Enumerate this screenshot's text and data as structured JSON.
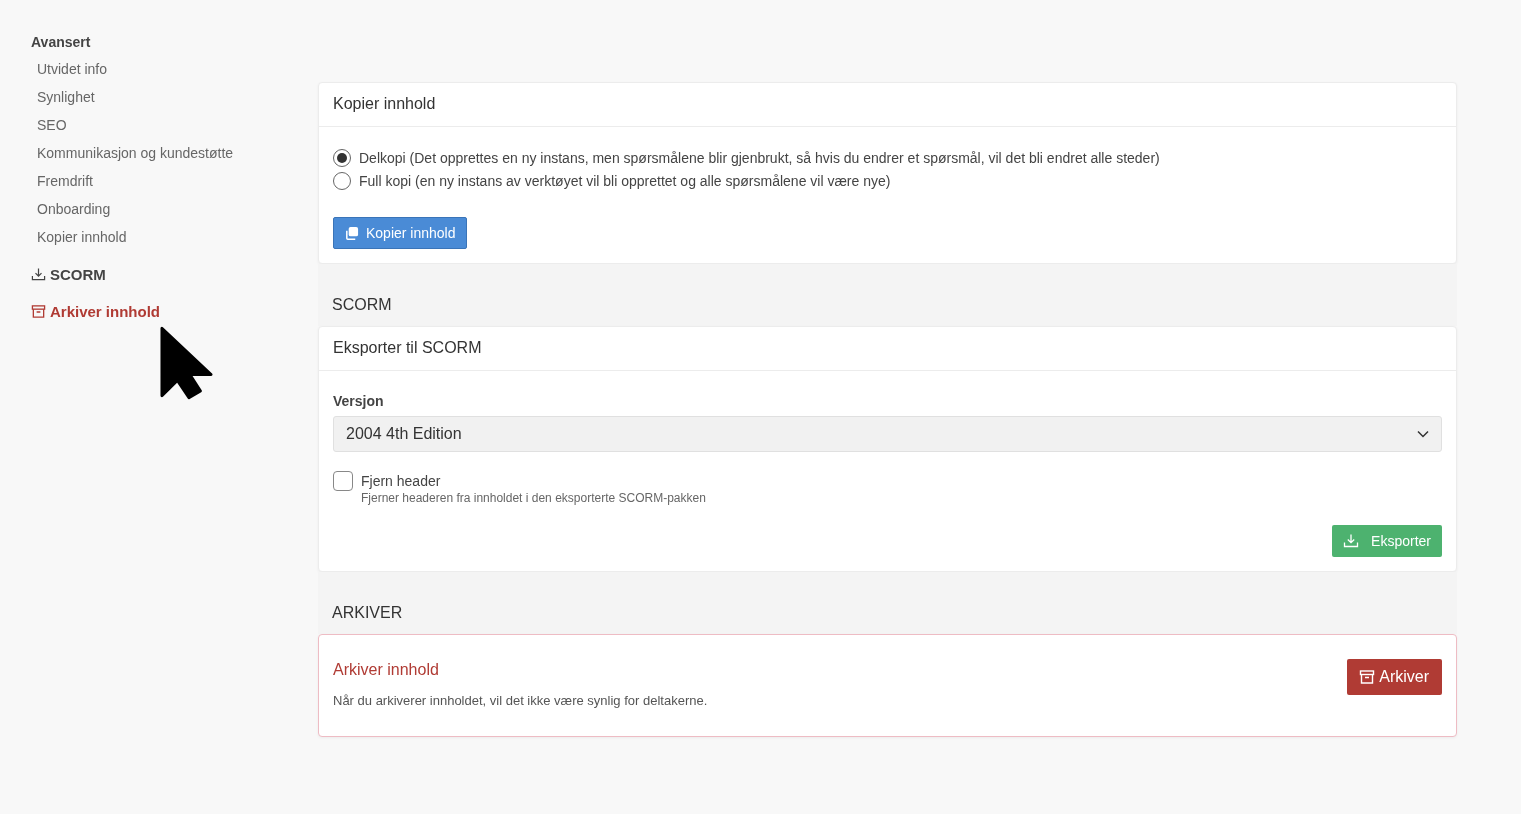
{
  "sidebar": {
    "heading": "Avansert",
    "items": [
      {
        "label": "Utvidet info"
      },
      {
        "label": "Synlighet"
      },
      {
        "label": "SEO"
      },
      {
        "label": "Kommunikasjon og kundestøtte"
      },
      {
        "label": "Fremdrift"
      },
      {
        "label": "Onboarding"
      },
      {
        "label": "Kopier innhold"
      }
    ],
    "sections": [
      {
        "label": "SCORM",
        "kind": "download"
      },
      {
        "label": "Arkiver innhold",
        "kind": "archive"
      }
    ]
  },
  "copy_card": {
    "title": "Kopier innhold",
    "options": [
      {
        "label": "Delkopi (Det opprettes en ny instans, men spørsmålene blir gjenbrukt, så hvis du endrer et spørsmål, vil det bli endret alle steder)",
        "selected": true
      },
      {
        "label": "Full kopi (en ny instans av verktøyet vil bli opprettet og alle spørsmålene vil være nye)",
        "selected": false
      }
    ],
    "button": "Kopier innhold"
  },
  "scorm": {
    "heading": "SCORM",
    "card_title": "Eksporter til SCORM",
    "version_label": "Versjon",
    "version_value": "2004 4th Edition",
    "checkbox": {
      "label": "Fjern header",
      "hint": "Fjerner headeren fra innholdet i den eksporterte SCORM-pakken",
      "checked": false
    },
    "button": "Eksporter"
  },
  "archive": {
    "heading": "ARKIVER",
    "title": "Arkiver innhold",
    "text": "Når du arkiverer innholdet, vil det ikke være synlig for deltakerne.",
    "button": "Arkiver"
  }
}
